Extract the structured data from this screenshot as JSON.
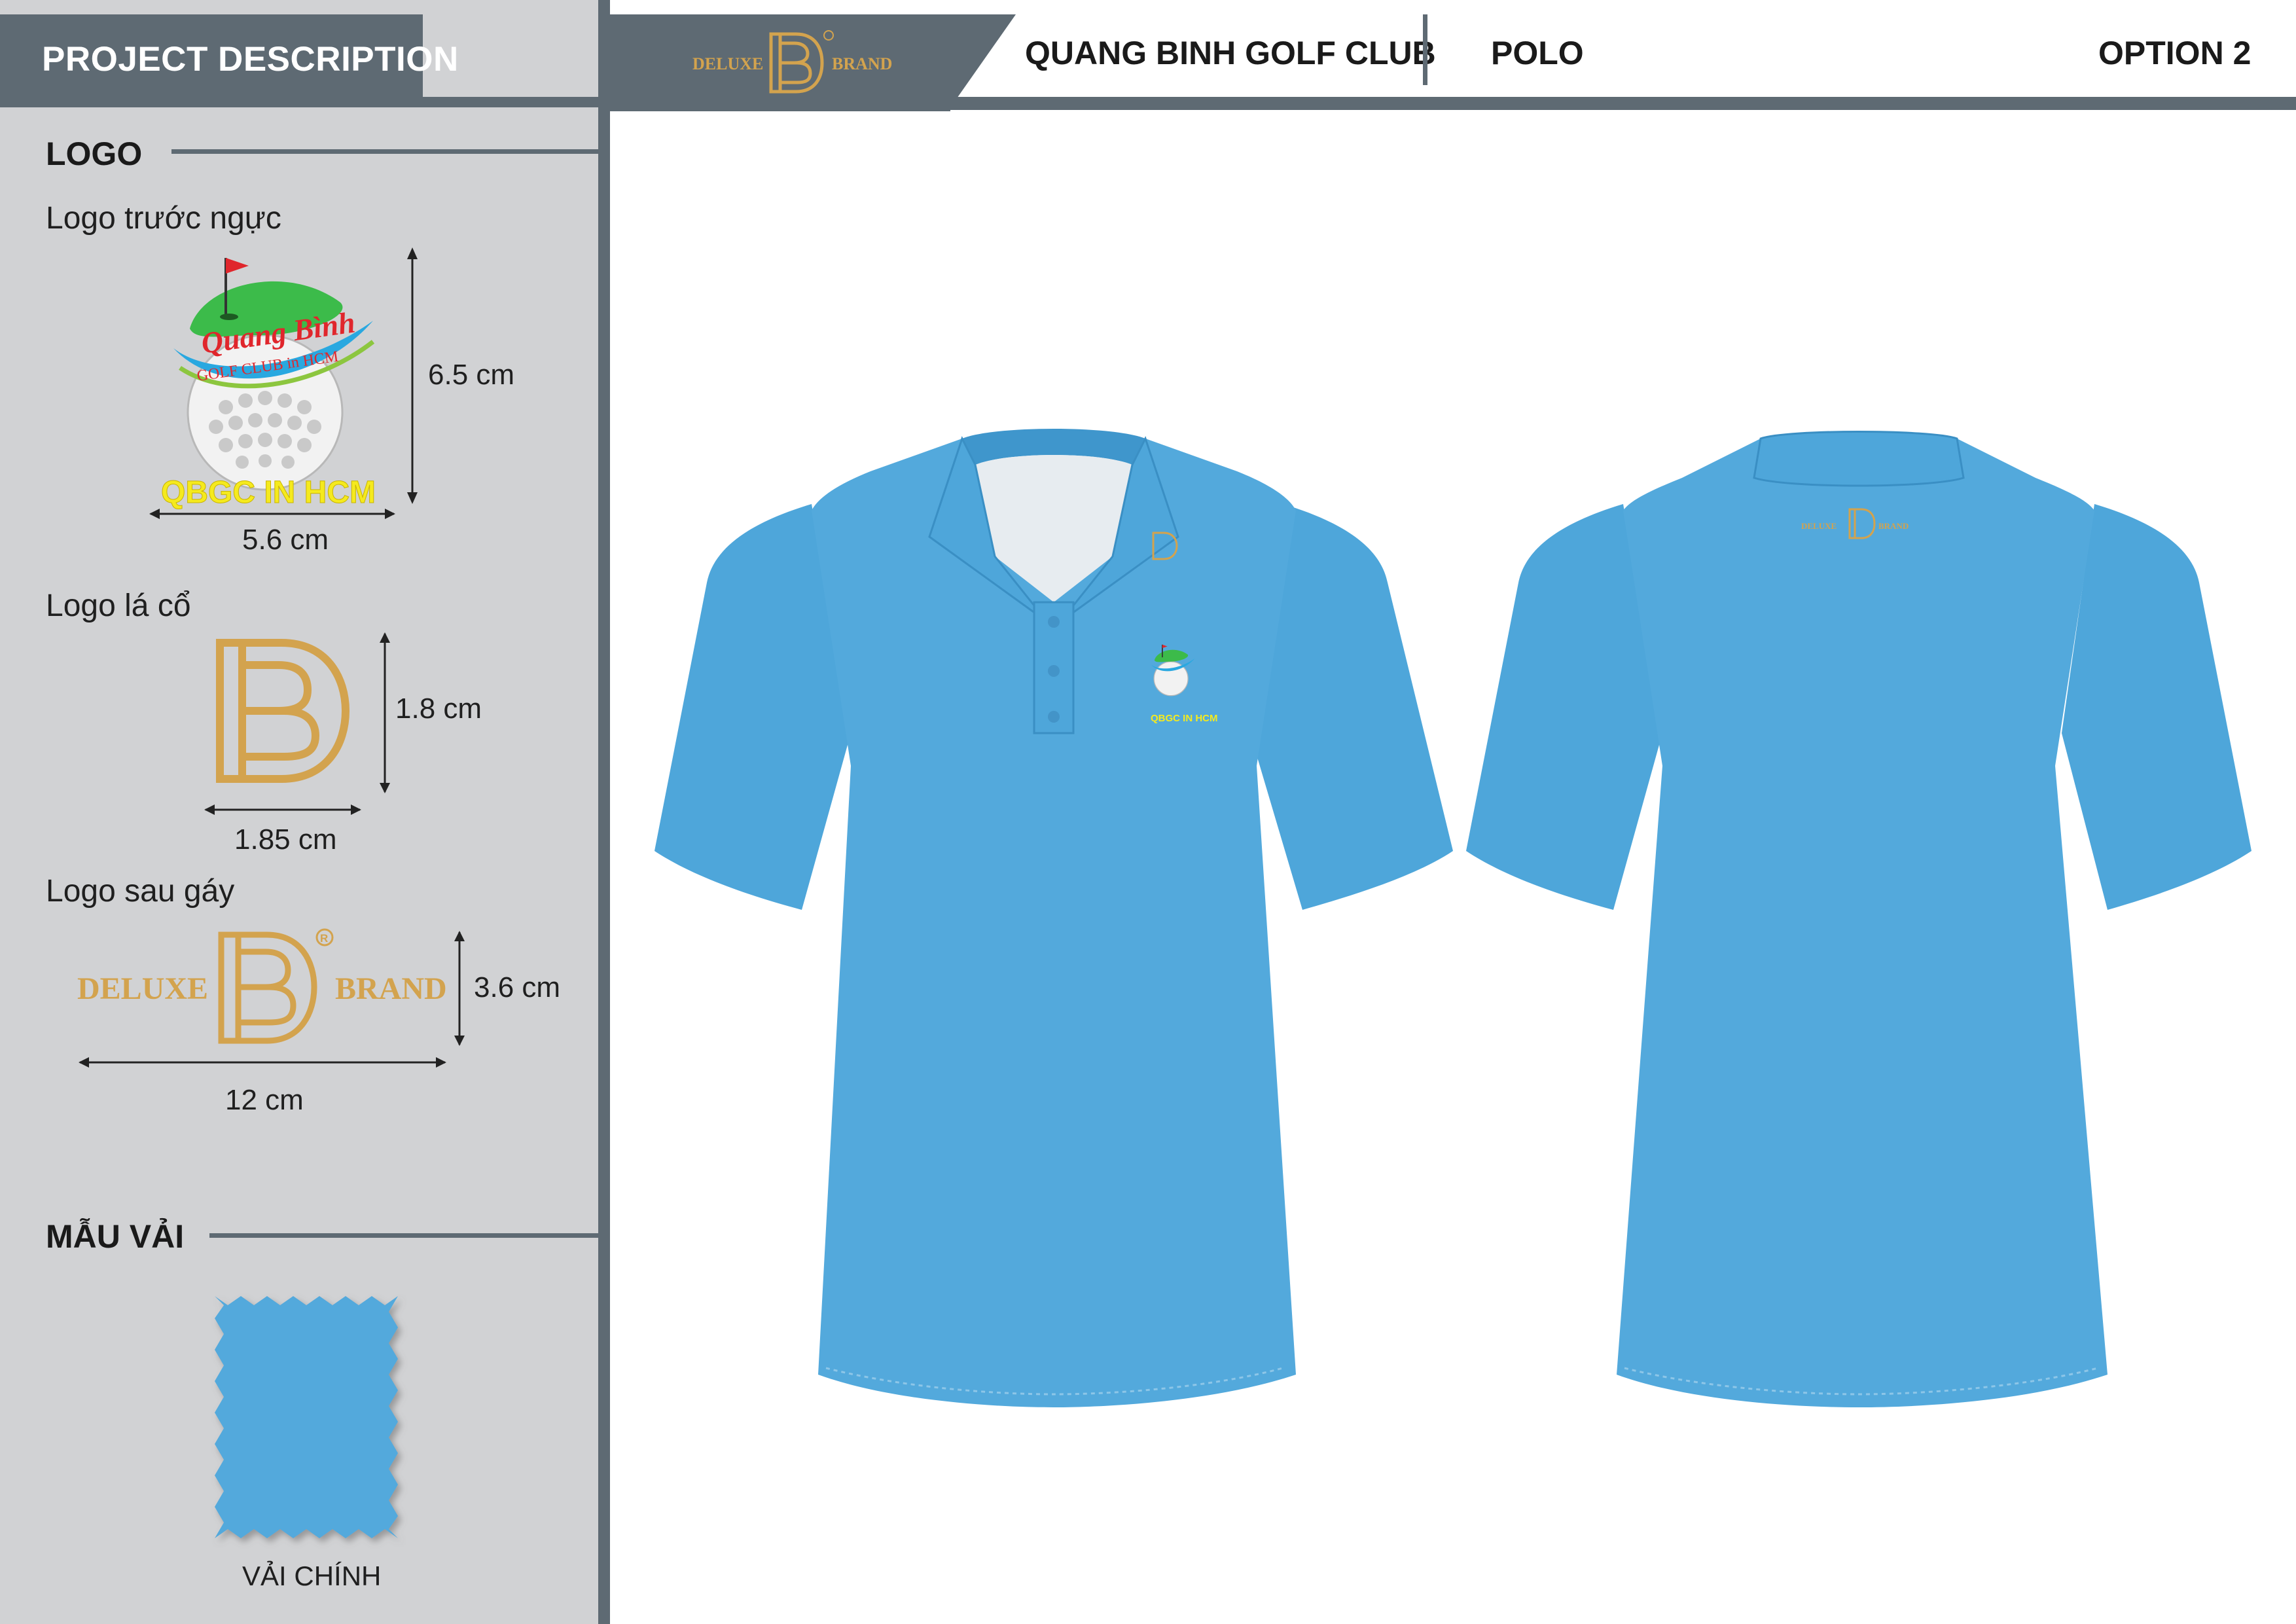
{
  "sidebar": {
    "title": "PROJECT DESCRIPTION",
    "logo_section": {
      "title": "LOGO",
      "chest": {
        "label": "Logo trước ngực",
        "height": "6.5 cm",
        "width": "5.6 cm",
        "logo_text_main": "Quang Bình",
        "logo_text_sub": "GOLF CLUB in HCM",
        "logo_caption": "QBGC IN HCM"
      },
      "collar": {
        "label": "Logo lá cổ",
        "height": "1.8 cm",
        "width": "1.85 cm"
      },
      "nape": {
        "label": "Logo sau gáy",
        "height": "3.6 cm",
        "width": "12 cm",
        "word_left": "DELUXE",
        "word_right": "BRAND"
      }
    },
    "fabric_section": {
      "title": "MẪU VẢI",
      "swatch_label": "VẢI CHÍNH",
      "swatch_color": "#53a9dc"
    }
  },
  "header": {
    "brand_left": "DELUXE",
    "brand_right": "BRAND",
    "client": "QUANG BINH GOLF CLUB",
    "product": "POLO",
    "option": "OPTION 2"
  },
  "garment": {
    "shirt_color": "#53a9dc",
    "front_chest_caption": "QBGC IN HCM",
    "back_brand_left": "DELUXE",
    "back_brand_right": "BRAND"
  },
  "colors": {
    "panel_gray": "#d1d2d4",
    "slate": "#5e6a73",
    "gold": "#d3a34e",
    "logo_green": "#3cbb4a",
    "logo_red": "#e0262c",
    "logo_yellow": "#f5ea1e"
  }
}
